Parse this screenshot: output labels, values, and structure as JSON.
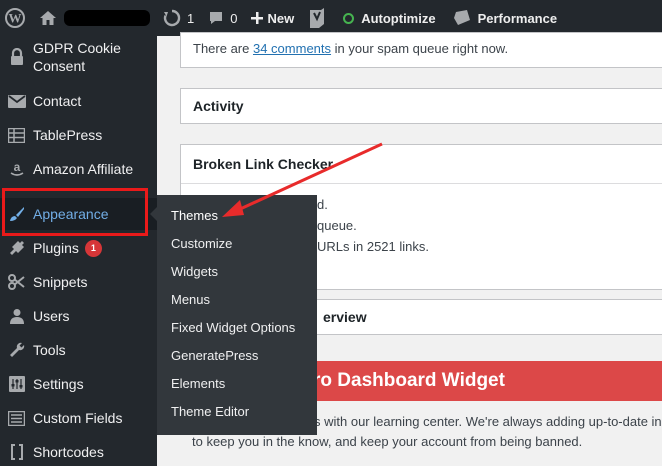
{
  "adminbar": {
    "updates_count": "1",
    "comments_count": "0",
    "new_label": "New",
    "autoptimize_label": "Autoptimize",
    "performance_label": "Performance"
  },
  "sidebar": {
    "items": [
      {
        "label": "GDPR Cookie Consent",
        "icon": "lock-icon"
      },
      {
        "label": "Contact",
        "icon": "mail-icon"
      },
      {
        "label": "TablePress",
        "icon": "table-icon"
      },
      {
        "label": "Amazon Affiliate",
        "icon": "amazon-icon"
      },
      {
        "label": "Appearance",
        "icon": "paintbrush-icon"
      },
      {
        "label": "Plugins",
        "icon": "plugin-icon",
        "badge": "1"
      },
      {
        "label": "Snippets",
        "icon": "scissors-icon"
      },
      {
        "label": "Users",
        "icon": "users-icon"
      },
      {
        "label": "Tools",
        "icon": "wrench-icon"
      },
      {
        "label": "Settings",
        "icon": "settings-icon"
      },
      {
        "label": "Custom Fields",
        "icon": "custom-fields-icon"
      },
      {
        "label": "Shortcodes",
        "icon": "brackets-icon"
      }
    ]
  },
  "submenu": {
    "items": [
      "Themes",
      "Customize",
      "Widgets",
      "Menus",
      "Fixed Widget Options",
      "GeneratePress",
      "Elements",
      "Theme Editor"
    ]
  },
  "main": {
    "spam_prefix": "There are ",
    "spam_link": "34 comments",
    "spam_suffix": " in your spam queue right now.",
    "activity_title": "Activity",
    "blc_title": "Broken Link Checker",
    "blc_line1": "d.",
    "blc_line2": "queue.",
    "blc_line3": "URLs in 2521 links.",
    "overview_title": "erview",
    "banner_title": "ro Dashboard Widget",
    "learn_line1": "s with our learning center. We're always adding up-to-date in",
    "learn_line2": "to keep you in the know, and keep your account from being banned."
  },
  "colors": {
    "adminbar_bg": "#23282d",
    "submenu_bg": "#32373c",
    "accent_blue": "#72aee6",
    "highlight_red": "#ea1a1a",
    "banner_red": "#dc4848",
    "badge_red": "#d63638"
  }
}
